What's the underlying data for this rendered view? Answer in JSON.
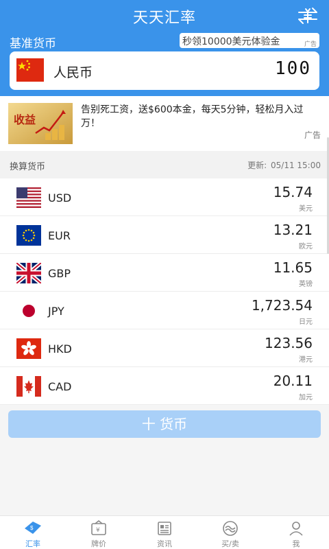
{
  "app": {
    "title": "天天汇率"
  },
  "base": {
    "label": "基准货币",
    "promo": {
      "text": "秒领10000美元体验金",
      "ad_tag": "广告"
    },
    "currency_name": "人民币",
    "amount": "100",
    "flag_icon": "china-flag-icon"
  },
  "ad": {
    "text": "告别死工资，送$600本金，每天5分钟，轻松月入过万！",
    "image_text": "收益",
    "label": "广告"
  },
  "section": {
    "title": "换算货币",
    "update_label": "更新:",
    "update_time": "05/11 15:00"
  },
  "currencies": [
    {
      "code": "USD",
      "value": "15.74",
      "unit": "美元",
      "flag_icon": "usa-flag-icon"
    },
    {
      "code": "EUR",
      "value": "13.21",
      "unit": "欧元",
      "flag_icon": "eu-flag-icon"
    },
    {
      "code": "GBP",
      "value": "11.65",
      "unit": "英镑",
      "flag_icon": "uk-flag-icon"
    },
    {
      "code": "JPY",
      "value": "1,723.54",
      "unit": "日元",
      "flag_icon": "japan-flag-icon"
    },
    {
      "code": "HKD",
      "value": "123.56",
      "unit": "港元",
      "flag_icon": "hongkong-flag-icon"
    },
    {
      "code": "CAD",
      "value": "20.11",
      "unit": "加元",
      "flag_icon": "canada-flag-icon"
    }
  ],
  "add_button": {
    "label": "十 货币"
  },
  "tabs": [
    {
      "label": "汇率",
      "icon": "exchange-rate-icon",
      "active": true
    },
    {
      "label": "牌价",
      "icon": "price-board-icon",
      "active": false
    },
    {
      "label": "资讯",
      "icon": "news-icon",
      "active": false
    },
    {
      "label": "买/卖",
      "icon": "trade-icon",
      "active": false
    },
    {
      "label": "我",
      "icon": "profile-icon",
      "active": false
    }
  ],
  "colors": {
    "primary": "#3a93ea",
    "add_button": "#a9d0f8"
  }
}
